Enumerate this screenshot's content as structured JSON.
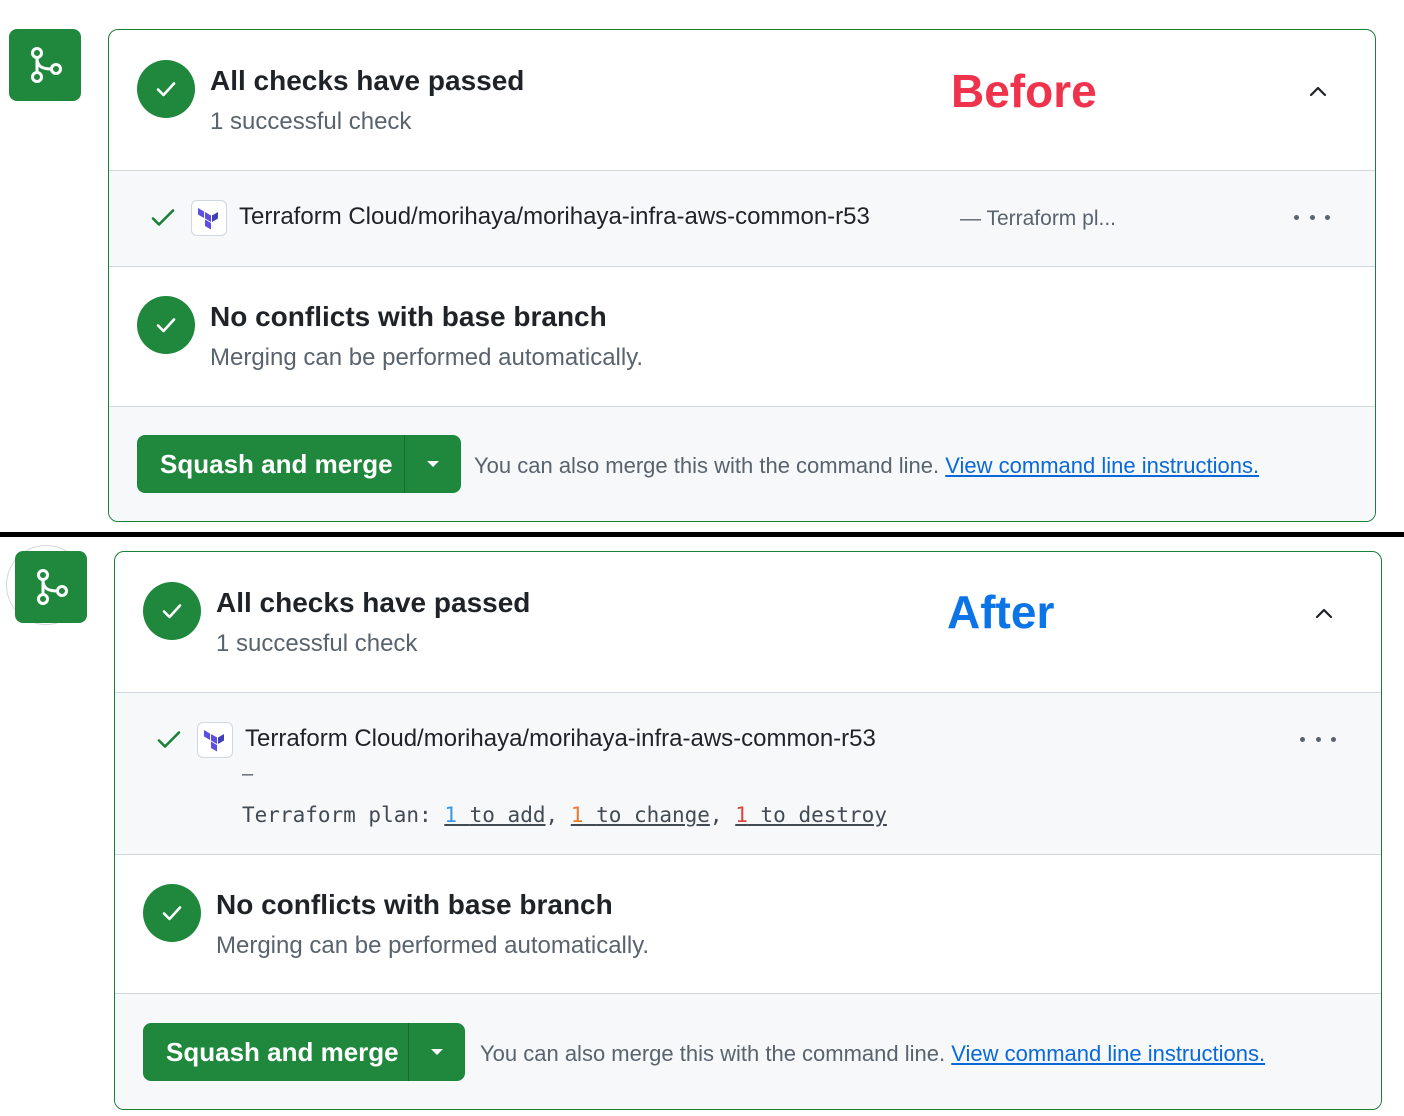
{
  "before": {
    "label": "Before",
    "label_color": "#f0334d",
    "checks_title": "All checks have passed",
    "checks_subtitle": "1 successful check",
    "check_item": {
      "name": "Terraform Cloud/morihaya/morihaya-infra-aws-common-r53",
      "description": "— Terraform pl..."
    },
    "conflicts_title": "No conflicts with base branch",
    "conflicts_subtitle": "Merging can be performed automatically.",
    "merge_button_label": "Squash and merge",
    "cli_text": "You can also merge this with the command line.",
    "cli_link": "View command line instructions."
  },
  "after": {
    "label": "After",
    "label_color": "#0b75e8",
    "checks_title": "All checks have passed",
    "checks_subtitle": "1 successful check",
    "check_item": {
      "name": "Terraform Cloud/morihaya/morihaya-infra-aws-common-r53",
      "dash": "–",
      "plan_prefix": "Terraform plan:",
      "add_count": "1",
      "add_text": "to add",
      "change_count": "1",
      "change_text": "to change",
      "destroy_count": "1",
      "destroy_text": "to destroy",
      "sep1": ",",
      "sep2": ","
    },
    "conflicts_title": "No conflicts with base branch",
    "conflicts_subtitle": "Merging can be performed automatically.",
    "merge_button_label": "Squash and merge",
    "cli_text": "You can also merge this with the command line.",
    "cli_link": "View command line instructions."
  },
  "colors": {
    "success_green": "#1f883d",
    "link_blue": "#0969da",
    "add_color": "#3b97e3",
    "change_color": "#e8792f",
    "destroy_color": "#e0453d"
  },
  "icons": [
    "git-merge-icon",
    "check-icon",
    "chevron-up-icon",
    "terraform-logo-icon",
    "kebab-menu-icon",
    "caret-down-icon"
  ]
}
